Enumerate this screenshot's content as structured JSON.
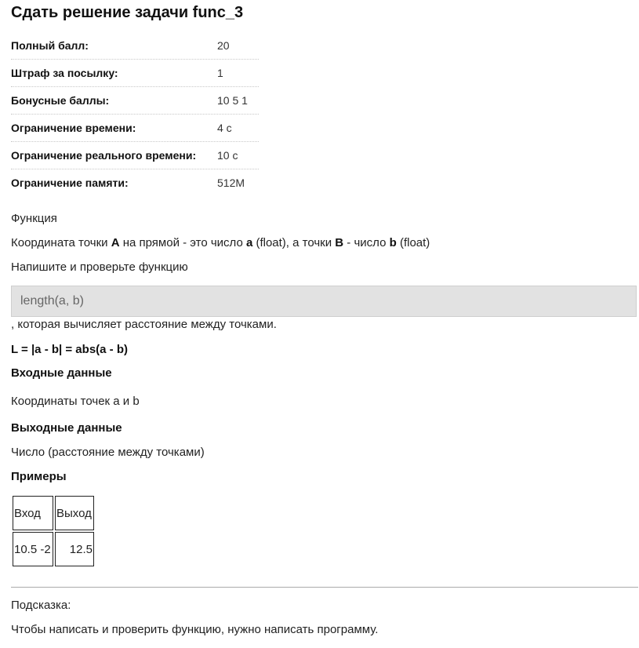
{
  "title": "Сдать решение задачи func_3",
  "limits": [
    {
      "label": "Полный балл:",
      "value": "20"
    },
    {
      "label": "Штраф за посылку:",
      "value": "1"
    },
    {
      "label": "Бонусные баллы:",
      "value": "10 5 1"
    },
    {
      "label": "Ограничение времени:",
      "value": "4 с"
    },
    {
      "label": "Ограничение реального времени:",
      "value": "10 с"
    },
    {
      "label": "Ограничение памяти:",
      "value": "512M"
    }
  ],
  "statement": {
    "section": "Функция",
    "line1": {
      "p1": "Координата точки ",
      "A": "A",
      "p2": " на прямой - это число ",
      "a": "a",
      "p3": " (float), а точки ",
      "B": "B",
      "p4": " - число ",
      "b": "b",
      "p5": " (float)"
    },
    "line2": "Напишите и проверьте функцию",
    "code": "length(a, b)",
    "line3": ", которая вычисляет расстояние между точками.",
    "formula": "L = |a - b| = abs(a - b)"
  },
  "input": {
    "heading": "Входные данные",
    "text": "Координаты точек a и b"
  },
  "output": {
    "heading": "Выходные данные",
    "text": "Число (расстояние между точками)"
  },
  "examples": {
    "heading": "Примеры",
    "headers": {
      "input": "Вход",
      "output": "Выход"
    },
    "rows": [
      {
        "input": "10.5 -2",
        "output": "12.5"
      }
    ]
  },
  "hint": {
    "label": "Подсказка:",
    "text": "Чтобы написать и проверить функцию, нужно написать программу."
  }
}
